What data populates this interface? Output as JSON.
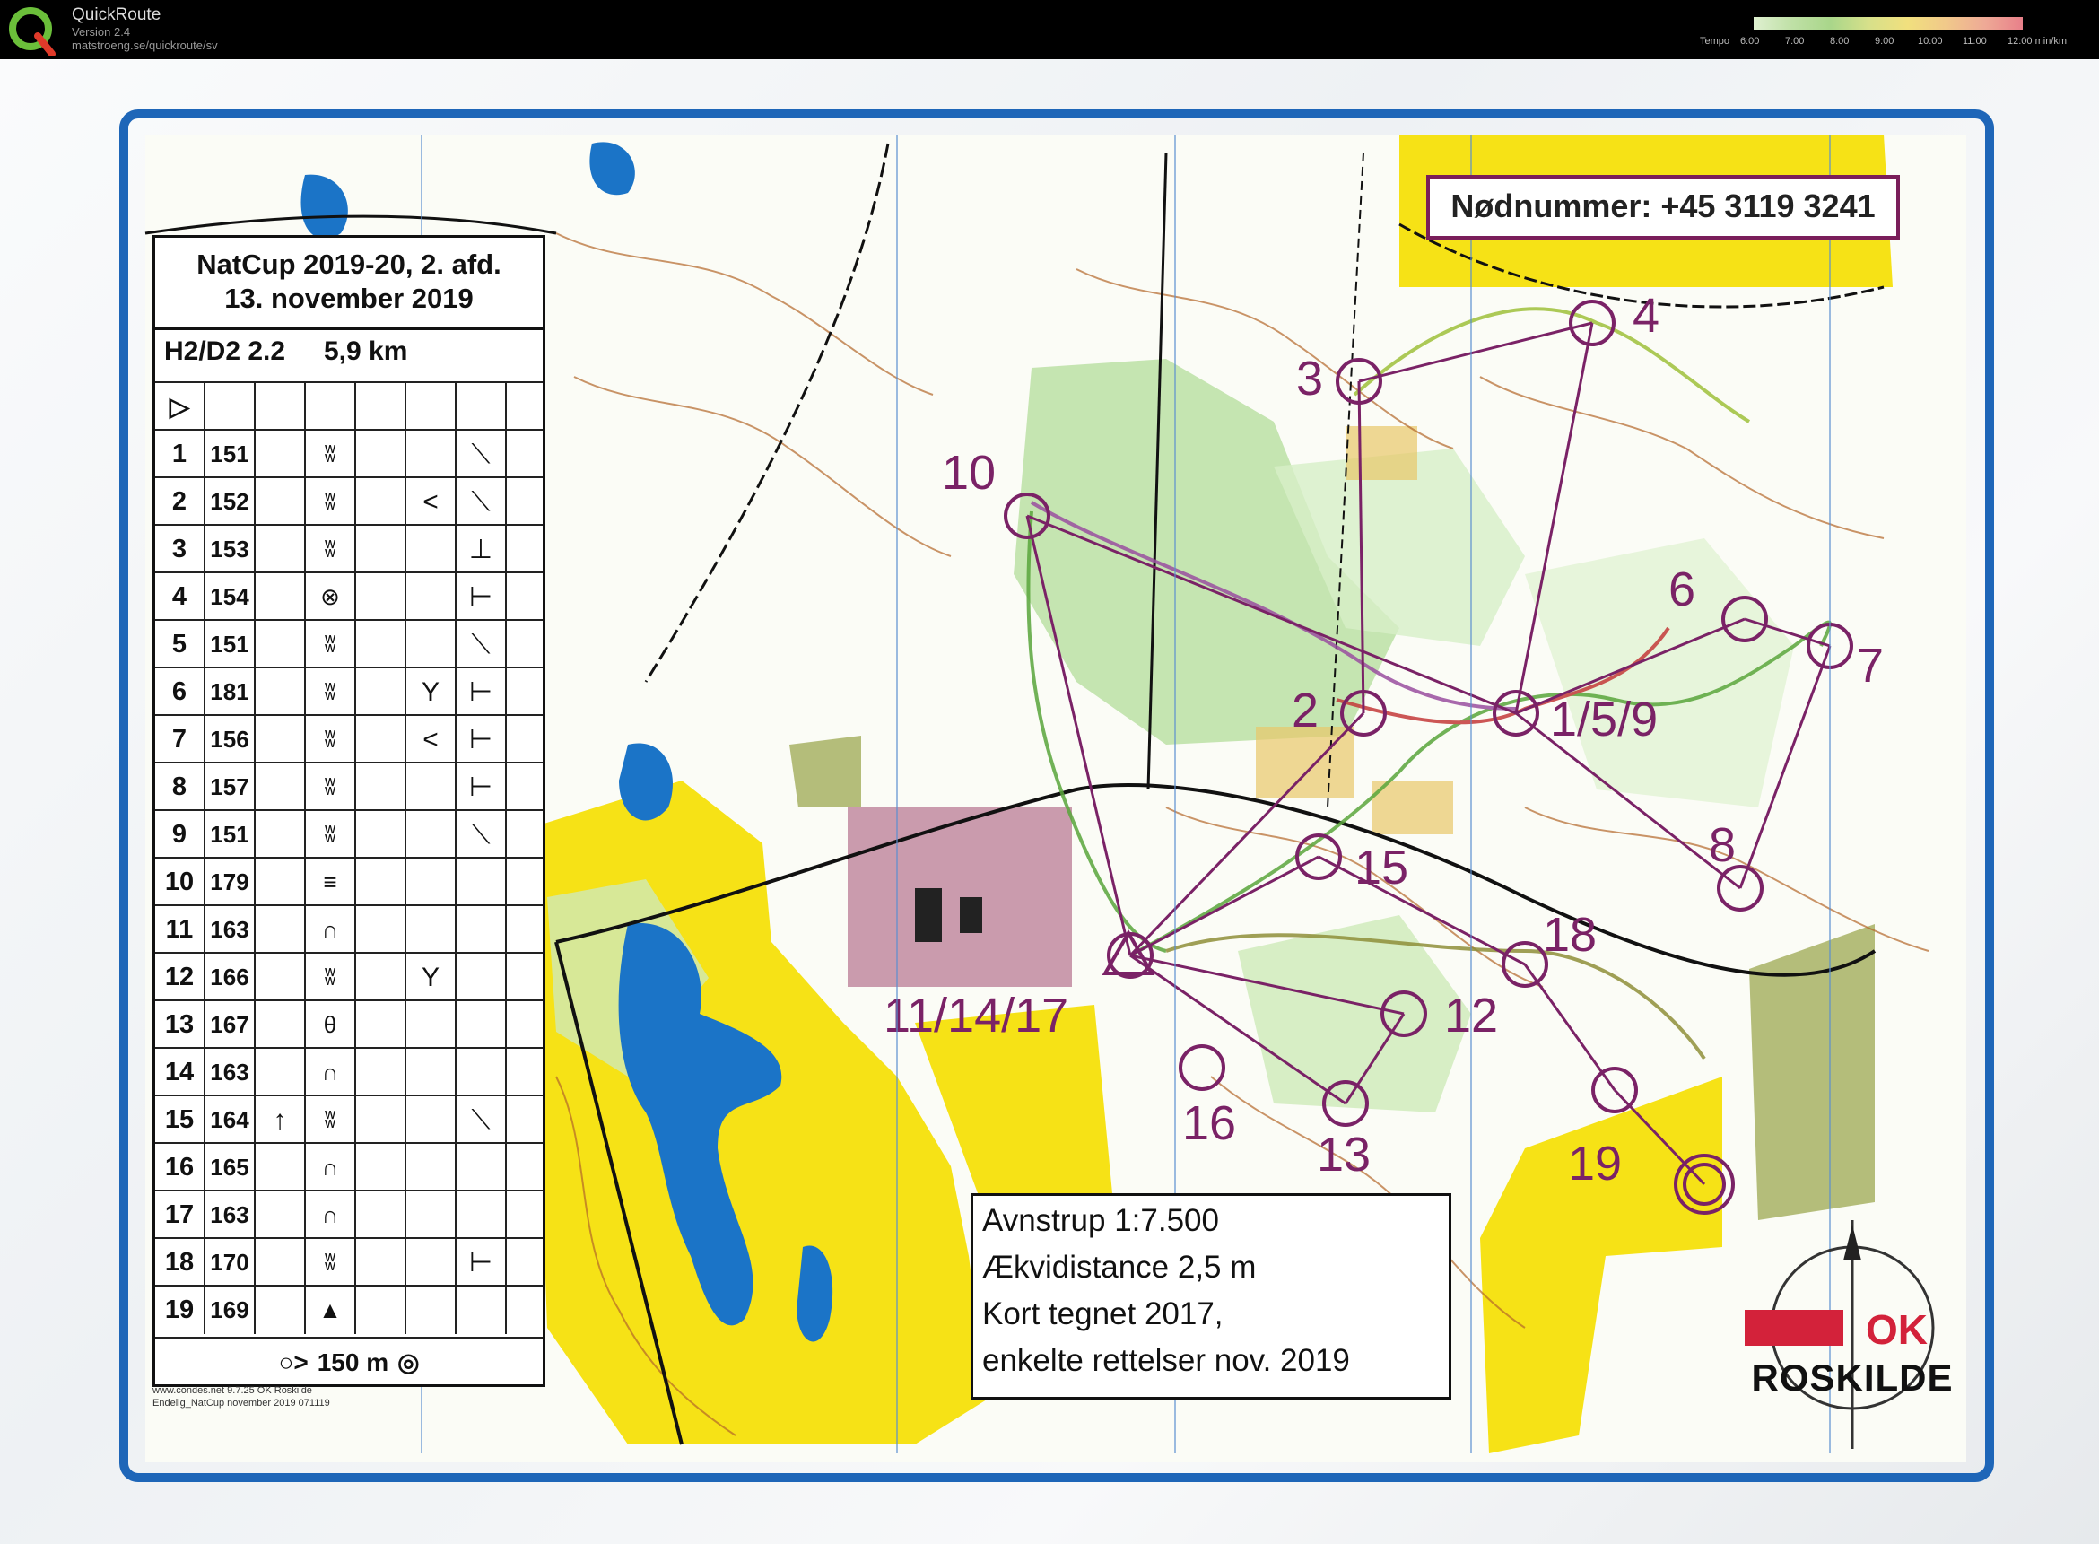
{
  "app": {
    "title": "QuickRoute",
    "version": "Version 2.4",
    "url": "matstroeng.se/quickroute/sv",
    "tempo_label": "Tempo",
    "tempo_ticks": [
      "6:00",
      "7:00",
      "8:00",
      "9:00",
      "10:00",
      "11:00",
      "12:00"
    ],
    "tempo_unit": "min/km",
    "tempo_colors": [
      "#dff0d0",
      "#bfe0a6",
      "#d7e08a",
      "#f1e07e",
      "#eeaa96",
      "#e8808a"
    ]
  },
  "card": {
    "title_line1": "NatCup 2019-20, 2. afd.",
    "title_line2": "13. november 2019",
    "class": "H2/D2 2.2",
    "length": "5,9 km",
    "start_symbol": "▷",
    "rows": [
      {
        "n": "1",
        "code": "151",
        "feature": "ʬ",
        "extra": "",
        "side": "⟍"
      },
      {
        "n": "2",
        "code": "152",
        "feature": "ʬ",
        "extra": "<",
        "side": "⟍"
      },
      {
        "n": "3",
        "code": "153",
        "feature": "ʬ",
        "extra": "",
        "side": "⊥"
      },
      {
        "n": "4",
        "code": "154",
        "feature": "⊗",
        "extra": "",
        "side": "⊢"
      },
      {
        "n": "5",
        "code": "151",
        "feature": "ʬ",
        "extra": "",
        "side": "⟍"
      },
      {
        "n": "6",
        "code": "181",
        "feature": "ʬ",
        "extra": "Y",
        "side": "⊢"
      },
      {
        "n": "7",
        "code": "156",
        "feature": "ʬ",
        "extra": "<",
        "side": "⊢"
      },
      {
        "n": "8",
        "code": "157",
        "feature": "ʬ",
        "extra": "",
        "side": "⊢"
      },
      {
        "n": "9",
        "code": "151",
        "feature": "ʬ",
        "extra": "",
        "side": "⟍"
      },
      {
        "n": "10",
        "code": "179",
        "feature": "≡",
        "extra": "",
        "side": ""
      },
      {
        "n": "11",
        "code": "163",
        "feature": "∩",
        "extra": "",
        "side": ""
      },
      {
        "n": "12",
        "code": "166",
        "feature": "ʬ",
        "extra": "Y",
        "side": ""
      },
      {
        "n": "13",
        "code": "167",
        "feature": "θ",
        "extra": "",
        "side": ""
      },
      {
        "n": "14",
        "code": "163",
        "feature": "∩",
        "extra": "",
        "side": ""
      },
      {
        "n": "15",
        "code": "164",
        "arrow": "↑",
        "feature": "ʬ",
        "extra": "",
        "side": "⟍"
      },
      {
        "n": "16",
        "code": "165",
        "feature": "∩",
        "extra": "",
        "side": ""
      },
      {
        "n": "17",
        "code": "163",
        "feature": "∩",
        "extra": "",
        "side": ""
      },
      {
        "n": "18",
        "code": "170",
        "feature": "ʬ",
        "extra": "",
        "side": "⊢"
      },
      {
        "n": "19",
        "code": "169",
        "feature": "▲",
        "extra": "",
        "side": ""
      }
    ],
    "footer": "150 m"
  },
  "map": {
    "emergency": "Nødnummer: +45 3119 3241",
    "scale_lines": [
      "Avnstrup 1:7.500",
      "Ækvidistance 2,5 m",
      "Kort tegnet 2017,",
      "enkelte rettelser nov. 2019"
    ],
    "copyright_line1": "www.condes.net 9.7.25 OK Roskilde",
    "copyright_line2": "Endelig_NatCup november 2019 071119",
    "club": "ROSKILDE",
    "club_logo_text": "OK",
    "control_labels": [
      "10",
      "3",
      "4",
      "6",
      "7",
      "2",
      "1/5/9",
      "8",
      "15",
      "18",
      "12",
      "11/14/17",
      "16",
      "13",
      "19"
    ],
    "colors": {
      "course": "#7a2266",
      "yellow": "#f6e216",
      "water": "#1b74c7",
      "green": "#a9d68a",
      "frame": "#1e66b8"
    }
  }
}
